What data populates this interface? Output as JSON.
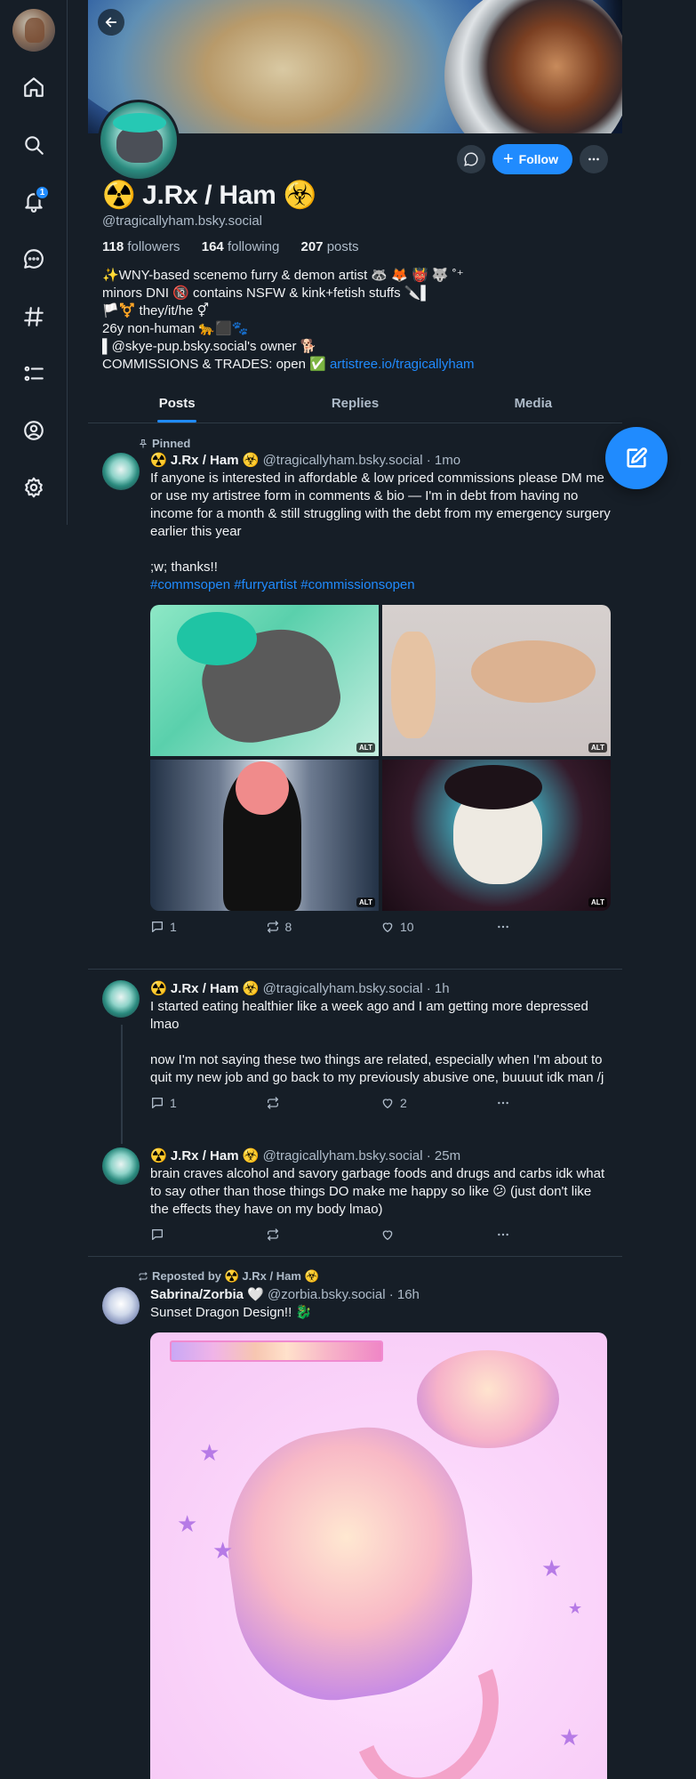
{
  "nav": {
    "notifications_badge": "1",
    "items": [
      "home-icon",
      "search-icon",
      "bell-icon",
      "chat-icon",
      "hashtag-icon",
      "list-icon",
      "user-icon",
      "gear-icon"
    ]
  },
  "profile": {
    "display_name": "☢️ J.Rx / Ham ☣️",
    "handle": "@tragicallyham.bsky.social",
    "followers_count": "118",
    "followers_label": "followers",
    "following_count": "164",
    "following_label": "following",
    "posts_count": "207",
    "posts_label": "posts",
    "follow_label": "Follow",
    "bio": [
      "✨WNY-based scenemo furry & demon artist 🦝 🦊 👹 🐺 ˚⁺",
      "minors DNI 🔞 contains NSFW & kink+fetish stuffs 🔪▌",
      "🏳️⚧️ they/it/he ⚥",
      "26y non-human 🐆⬛🐾",
      "▌@skye-pup.bsky.social's owner 🐕"
    ],
    "bio_commissions": "COMMISSIONS & TRADES: open ✅ ",
    "bio_link": "artistree.io/tragicallyham"
  },
  "tabs": [
    "Posts",
    "Replies",
    "Media"
  ],
  "posts": [
    {
      "context": "Pinned",
      "name": "☢️ J.Rx / Ham ☣️",
      "meta": "@tragicallyham.bsky.social · 1mo",
      "text": "If anyone is interested in affordable & low priced commissions please DM me or use my artistree form in comments & bio — I'm in debt from having no income for a month & still struggling with the debt from my emergency surgery earlier this year\n\n;w; thanks!!\n",
      "tags": "#commsopen #furryartist #commissionsopen",
      "alt_label": "ALT",
      "replies": "1",
      "reposts": "8",
      "likes": "10"
    },
    {
      "name": "☢️ J.Rx / Ham ☣️",
      "meta": "@tragicallyham.bsky.social · 1h",
      "text": "I started eating healthier like a week ago and I am getting more depressed lmao\n\nnow I'm not saying these two things are related, especially when I'm about to quit my new job and go back to my previously abusive one, buuuut idk man /j",
      "replies": "1",
      "reposts": "",
      "likes": "2"
    },
    {
      "name": "☢️ J.Rx / Ham ☣️",
      "meta": "@tragicallyham.bsky.social · 25m",
      "text": "brain craves alcohol and savory garbage foods and drugs and carbs idk what to say other than those things DO make me happy so like 😕 (just don't like the effects they have on my body lmao)",
      "replies": "",
      "reposts": "",
      "likes": ""
    },
    {
      "context": "Reposted by ☢️ J.Rx / Ham ☣️",
      "name": "Sabrina/Zorbia 🤍",
      "meta": "@zorbia.bsky.social · 16h",
      "text": "Sunset Dragon Design!! 🐉"
    }
  ]
}
